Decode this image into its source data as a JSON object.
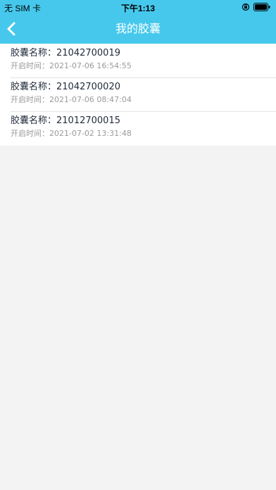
{
  "status_bar": {
    "carrier": "无 SIM 卡",
    "time": "下午1:13",
    "icons": [
      "orientation-lock-icon",
      "battery-icon"
    ]
  },
  "nav": {
    "title": "我的胶囊",
    "back_icon": "chevron-left-icon"
  },
  "colors": {
    "header_bg": "#46c8ec",
    "page_bg": "#f3f3f3",
    "name_text": "#1f2a3a",
    "time_text": "#9a9a9a"
  },
  "capsules": [
    {
      "name_label": "胶囊名称：",
      "name_value": "21042700019",
      "time_label": "开启时间：",
      "time_value": "2021-07-06 16:54:55"
    },
    {
      "name_label": "胶囊名称：",
      "name_value": "21042700020",
      "time_label": "开启时间：",
      "time_value": "2021-07-06 08:47:04"
    },
    {
      "name_label": "胶囊名称：",
      "name_value": "21012700015",
      "time_label": "开启时间：",
      "time_value": "2021-07-02 13:31:48"
    }
  ]
}
